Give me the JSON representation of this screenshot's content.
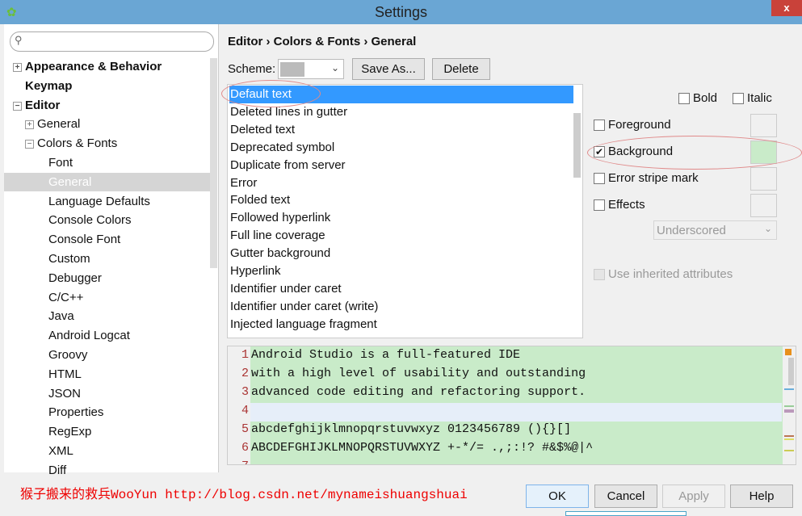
{
  "window": {
    "title": "Settings",
    "close": "x"
  },
  "search": {
    "placeholder": "",
    "icon": "search-icon"
  },
  "tree": [
    {
      "label": "Appearance & Behavior",
      "bold": true,
      "expander": "+"
    },
    {
      "label": "Keymap",
      "bold": true
    },
    {
      "label": "Editor",
      "bold": true,
      "expander": "−"
    },
    {
      "label": "General",
      "expander": "+"
    },
    {
      "label": "Colors & Fonts",
      "expander": "−"
    },
    {
      "label": "Font"
    },
    {
      "label": "General",
      "selected": true
    },
    {
      "label": "Language Defaults"
    },
    {
      "label": "Console Colors"
    },
    {
      "label": "Console Font"
    },
    {
      "label": "Custom"
    },
    {
      "label": "Debugger"
    },
    {
      "label": "C/C++"
    },
    {
      "label": "Java"
    },
    {
      "label": "Android Logcat"
    },
    {
      "label": "Groovy"
    },
    {
      "label": "HTML"
    },
    {
      "label": "JSON"
    },
    {
      "label": "Properties"
    },
    {
      "label": "RegExp"
    },
    {
      "label": "XML"
    },
    {
      "label": "Diff"
    }
  ],
  "breadcrumb": "Editor › Colors & Fonts › General",
  "scheme": {
    "label": "Scheme:",
    "save_as": "Save As...",
    "delete": "Delete"
  },
  "list": [
    "Default text",
    "Deleted lines in gutter",
    "Deleted text",
    "Deprecated symbol",
    "Duplicate from server",
    "Error",
    "Folded text",
    "Followed hyperlink",
    "Full line coverage",
    "Gutter background",
    "Hyperlink",
    "Identifier under caret",
    "Identifier under caret (write)",
    "Injected language fragment"
  ],
  "attributes": {
    "bold": "Bold",
    "italic": "Italic",
    "foreground": "Foreground",
    "background": "Background",
    "background_checked": true,
    "error_stripe": "Error stripe mark",
    "effects": "Effects",
    "effect_type": "Underscored",
    "use_inherited": "Use inherited attributes",
    "background_color": "#c9ebc9"
  },
  "preview": {
    "lines": [
      {
        "n": "1",
        "t": "Android Studio is a full-featured IDE"
      },
      {
        "n": "2",
        "t": "with a high level of usability and outstanding"
      },
      {
        "n": "3",
        "t": "advanced code editing and refactoring support."
      },
      {
        "n": "4",
        "t": ""
      },
      {
        "n": "5",
        "t": "abcdefghijklmnopqrstuvwxyz 0123456789 (){}[]"
      },
      {
        "n": "6",
        "t": "ABCDEFGHIJKLMNOPQRSTUVWXYZ +-*/= .,;:!? #&$%@|^"
      },
      {
        "n": "7",
        "t": ""
      }
    ]
  },
  "watermark": "猴子搬来的救兵WooYun http://blog.csdn.net/mynameishuangshuai",
  "buttons": {
    "ok": "OK",
    "cancel": "Cancel",
    "apply": "Apply",
    "help": "Help"
  }
}
